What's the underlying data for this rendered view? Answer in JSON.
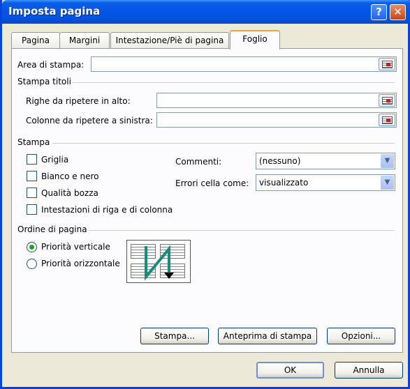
{
  "window": {
    "title": "Imposta pagina",
    "help_glyph": "?",
    "close_glyph": "✕"
  },
  "tabs": [
    {
      "label": "Pagina"
    },
    {
      "label": "Margini"
    },
    {
      "label": "Intestazione/Piè di pagina"
    },
    {
      "label": "Foglio"
    }
  ],
  "active_tab": "Foglio",
  "print_area": {
    "label": "Area di stampa:",
    "value": ""
  },
  "titles_section": {
    "heading": "Stampa titoli",
    "rows_label": "Righe da ripetere in alto:",
    "rows_value": "",
    "cols_label": "Colonne da ripetere a sinistra:",
    "cols_value": ""
  },
  "print_section": {
    "heading": "Stampa",
    "checkboxes": [
      {
        "label": "Griglia",
        "checked": false
      },
      {
        "label": "Bianco e nero",
        "checked": false
      },
      {
        "label": "Qualità bozza",
        "checked": false
      },
      {
        "label": "Intestazioni di riga e di colonna",
        "checked": false
      }
    ],
    "comments_label": "Commenti:",
    "comments_value": "(nessuno)",
    "errors_label": "Errori cella come:",
    "errors_value": "visualizzato"
  },
  "order_section": {
    "heading": "Ordine di pagina",
    "options": [
      {
        "label": "Priorità verticale",
        "selected": true
      },
      {
        "label": "Priorità orizzontale",
        "selected": false
      }
    ]
  },
  "buttons": {
    "print": "Stampa...",
    "preview": "Anteprima di stampa",
    "options": "Opzioni...",
    "ok": "OK",
    "cancel": "Annulla"
  },
  "colors": {
    "titlebar": "#0555e6",
    "dialog_bg": "#ece9d8",
    "active_tab_accent": "#f1a638",
    "arrow_green": "#1a8a7a"
  },
  "icons": {
    "ref_button": "range-select-icon",
    "dropdown": "chevron-down-icon"
  }
}
